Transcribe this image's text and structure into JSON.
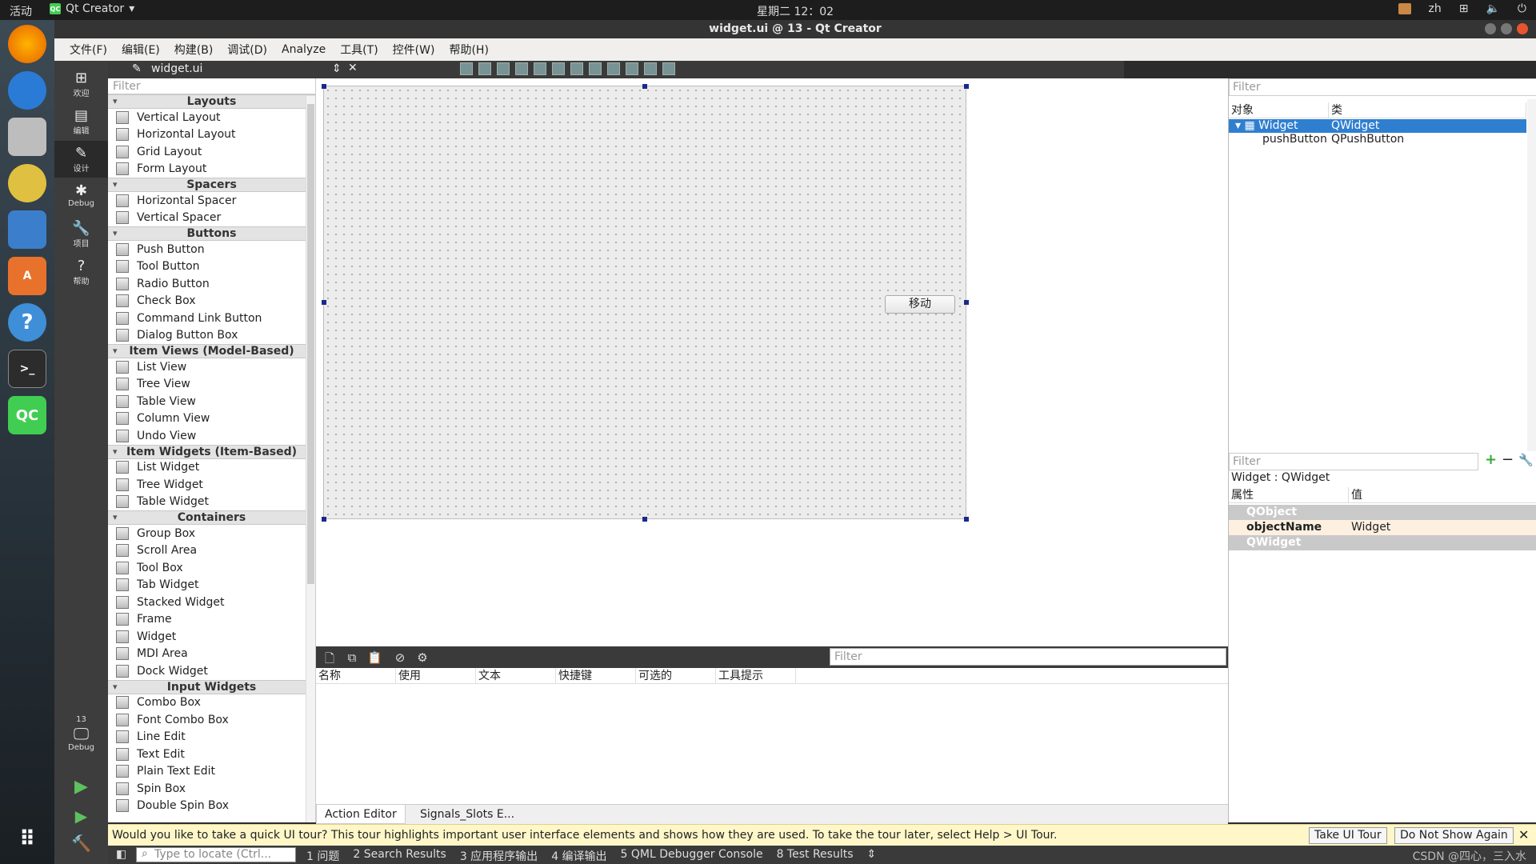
{
  "system_bar": {
    "activities": "活动",
    "app_name": "Qt Creator",
    "app_badge": "QC",
    "clock": "星期二 12：02",
    "input_method": "zh"
  },
  "window": {
    "title": "widget.ui @ 13 - Qt Creator"
  },
  "menu": [
    "文件(F)",
    "编辑(E)",
    "构建(B)",
    "调试(D)",
    "Analyze",
    "工具(T)",
    "控件(W)",
    "帮助(H)"
  ],
  "modes": {
    "welcome": "欢迎",
    "edit": "编辑",
    "design": "设计",
    "debug": "Debug",
    "projects": "项目",
    "help": "帮助",
    "kit_number": "13",
    "kit_label": "Debug"
  },
  "doc": {
    "filename": "widget.ui"
  },
  "widget_box": {
    "filter_placeholder": "Filter",
    "categories": [
      {
        "name": "Layouts",
        "items": [
          "Vertical Layout",
          "Horizontal Layout",
          "Grid Layout",
          "Form Layout"
        ]
      },
      {
        "name": "Spacers",
        "items": [
          "Horizontal Spacer",
          "Vertical Spacer"
        ]
      },
      {
        "name": "Buttons",
        "items": [
          "Push Button",
          "Tool Button",
          "Radio Button",
          "Check Box",
          "Command Link Button",
          "Dialog Button Box"
        ]
      },
      {
        "name": "Item Views (Model-Based)",
        "items": [
          "List View",
          "Tree View",
          "Table View",
          "Column View",
          "Undo View"
        ]
      },
      {
        "name": "Item Widgets (Item-Based)",
        "items": [
          "List Widget",
          "Tree Widget",
          "Table Widget"
        ]
      },
      {
        "name": "Containers",
        "items": [
          "Group Box",
          "Scroll Area",
          "Tool Box",
          "Tab Widget",
          "Stacked Widget",
          "Frame",
          "Widget",
          "MDI Area",
          "Dock Widget"
        ]
      },
      {
        "name": "Input Widgets",
        "items": [
          "Combo Box",
          "Font Combo Box",
          "Line Edit",
          "Text Edit",
          "Plain Text Edit",
          "Spin Box",
          "Double Spin Box"
        ]
      }
    ]
  },
  "form": {
    "button_text": "移动"
  },
  "action_editor": {
    "filter_placeholder": "Filter",
    "columns": [
      "名称",
      "使用",
      "文本",
      "快捷键",
      "可选的",
      "工具提示"
    ],
    "tabs": [
      "Action Editor",
      "Signals_Slots E..."
    ]
  },
  "object_inspector": {
    "filter_placeholder": "Filter",
    "col_object": "对象",
    "col_class": "类",
    "rows": [
      {
        "object": "Widget",
        "class": "QWidget"
      },
      {
        "object": "pushButton",
        "class": "QPushButton"
      }
    ]
  },
  "property_editor": {
    "filter_placeholder": "Filter",
    "title": "Widget : QWidget",
    "col_property": "属性",
    "col_value": "值",
    "group_qobject": "QObject",
    "object_name_label": "objectName",
    "object_name_value": "Widget",
    "group_qwidget": "QWidget"
  },
  "tour": {
    "message": "Would you like to take a quick UI tour? This tour highlights important user interface elements and shows how they are used. To take the tour later, select Help > UI Tour.",
    "take": "Take UI Tour",
    "dismiss": "Do Not Show Again"
  },
  "status": {
    "locate_placeholder": "Type to locate (Ctrl...",
    "items": [
      "1 问题",
      "2 Search Results",
      "3 应用程序输出",
      "4 编译输出",
      "5 QML Debugger Console",
      "8 Test Results"
    ],
    "watermark": "CSDN @四心，三入水"
  }
}
